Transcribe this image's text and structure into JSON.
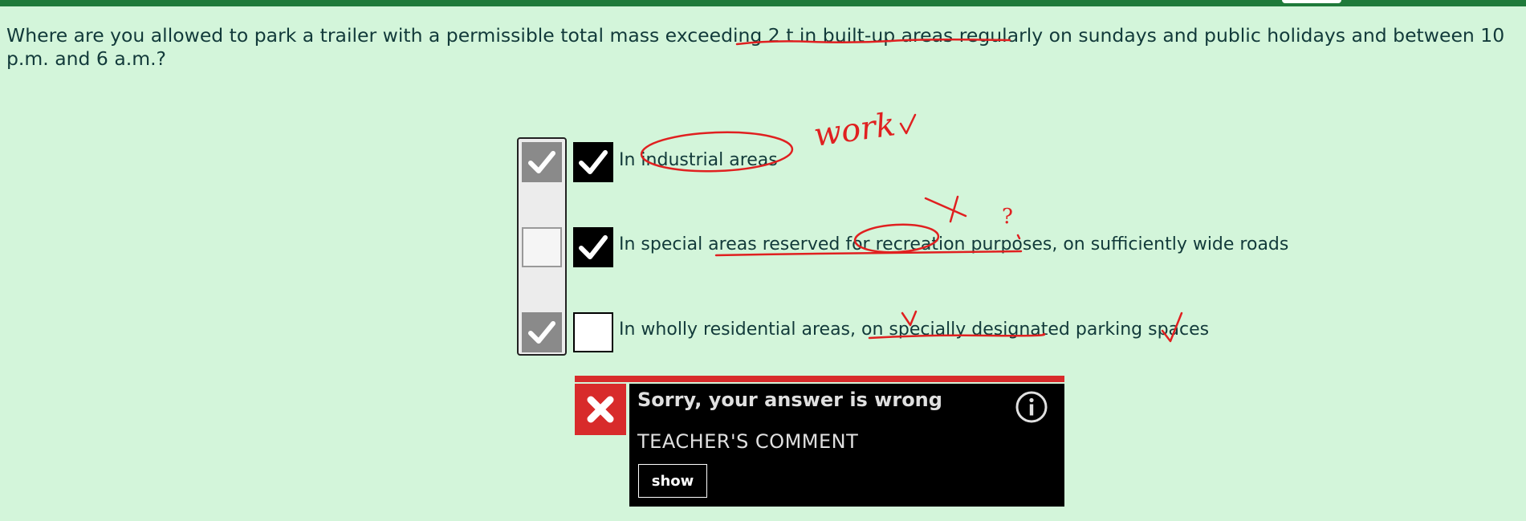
{
  "question": {
    "text": "Where are you allowed to park a trailer with a permissible total mass exceeding 2 t in built-up areas regularly on sundays and public holidays and between 10 p.m. and 6 a.m.?"
  },
  "answers": [
    {
      "text": "In industrial areas",
      "correct": true,
      "selected": true
    },
    {
      "text": "In special areas reserved for recreation purposes, on sufficiently wide roads",
      "correct": false,
      "selected": true
    },
    {
      "text": "In wholly residential areas, on specially designated parking spaces",
      "correct": true,
      "selected": false
    }
  ],
  "result": {
    "title": "Sorry, your answer is wrong",
    "teacher_comment_label": "TEACHER'S COMMENT",
    "show_label": "show"
  },
  "annotation_marks": {
    "note_work": "work",
    "note_question": "?"
  },
  "colors": {
    "background": "#d3f5da",
    "topbar": "#1f7a3a",
    "text": "#123a3a",
    "error": "#d82b2b",
    "annotation": "#e02020"
  },
  "icons": {
    "result": "close-x-icon",
    "info": "info-icon",
    "check": "checkmark-icon"
  }
}
